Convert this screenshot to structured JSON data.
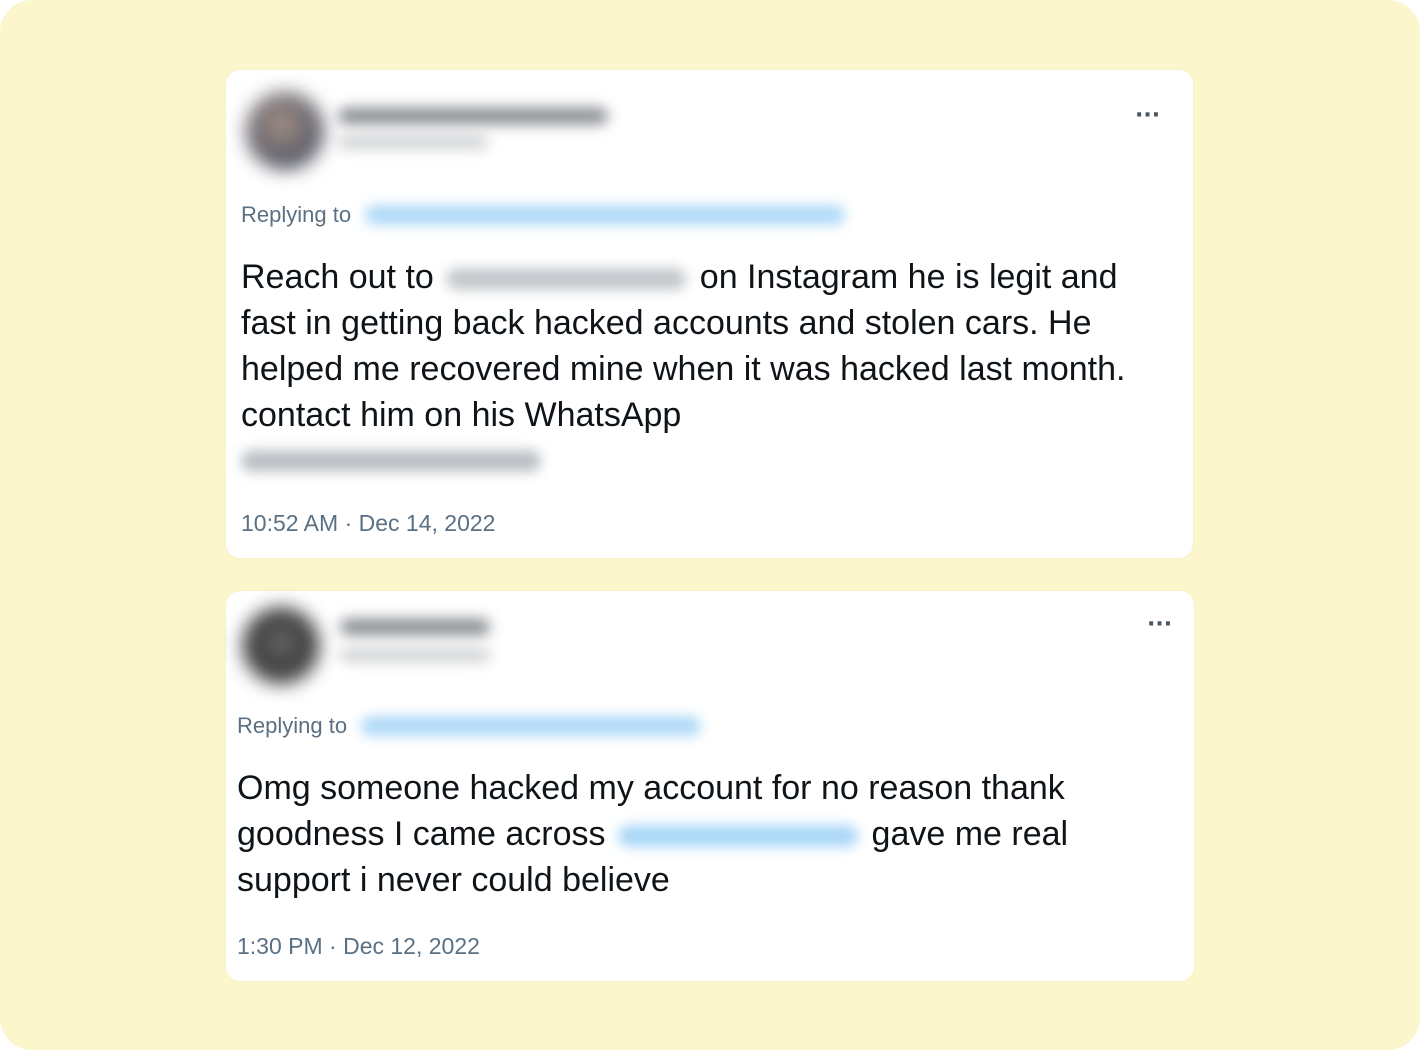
{
  "tweets": [
    {
      "more_icon": "more-horizontal-icon",
      "replying_label": "Replying to",
      "text_part_1": "Reach out to",
      "text_part_2": "on Instagram he is legit and fast in getting back hacked accounts and stolen cars. He helped me recovered mine when it was hacked last month. contact him on his WhatsApp",
      "timestamp": "10:52 AM · Dec 14, 2022"
    },
    {
      "more_icon": "more-horizontal-icon",
      "replying_label": "Replying to",
      "text_part_1": "Omg someone hacked my account for no reason thank goodness I came across",
      "text_part_2": "gave me real support i never could believe",
      "timestamp": "1:30 PM · Dec 12, 2022"
    }
  ],
  "colors": {
    "background": "#fcf6cc",
    "card": "#ffffff",
    "text": "#0f1419",
    "secondary_text": "#5b7083",
    "link_blur": "#7cc1f3"
  }
}
